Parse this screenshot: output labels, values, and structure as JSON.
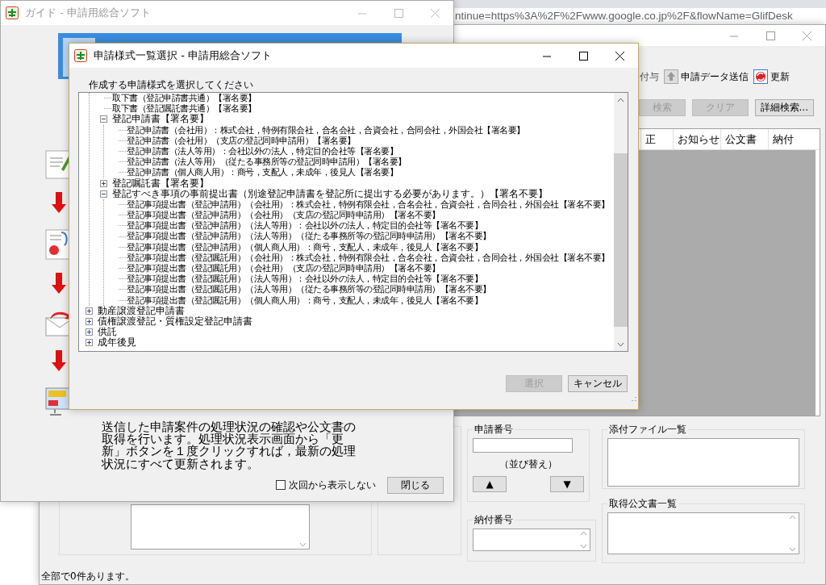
{
  "browser": {
    "address_fragment": "ntinue=https%3A%2F%2Fwww.google.co.jp%2F&flowName=GlifDesk"
  },
  "main_window": {
    "toolbar": [
      {
        "label": "付与",
        "kind": "text"
      },
      {
        "label": "申請データ送信",
        "kind": "upload"
      },
      {
        "label": "更新",
        "kind": "refresh"
      }
    ],
    "search_buttons": [
      {
        "label": "検索",
        "disabled": true
      },
      {
        "label": "クリア",
        "disabled": true
      },
      {
        "label": "詳細検索...",
        "disabled": false
      }
    ],
    "table": {
      "columns": [
        "正",
        "お知らせ",
        "公文書",
        "納付"
      ]
    },
    "application_number": {
      "label": "申請番号"
    },
    "sort": {
      "label": "（並び替え）",
      "buttons": [
        "▲",
        "▼"
      ]
    },
    "payment_number": {
      "label": "納付番号"
    },
    "attachments": {
      "label": "添付ファイル一覧"
    },
    "documents": {
      "label": "取得公文書一覧"
    },
    "status_bar": "全部で0件あります。"
  },
  "guide_window": {
    "title": "ガイド - 申請用総合ソフト",
    "active": false,
    "description": "送信した申請案件の処理状況の確認や公文書の取得を行います。処理状況表示画面から「更新」ボタンを１度クリックすれば，最新の処理状況にすべて更新されます。",
    "dont_show_again": {
      "label": "次回から表示しない",
      "checked": false
    },
    "close_button": "閉じる"
  },
  "dialog": {
    "title": "申請様式一覧選択 - 申請用総合ソフト",
    "active": true,
    "prompt": "作成する申請様式を選択してください",
    "tree": [
      {
        "expanded": true,
        "children": [
          {
            "label": "取下書（登記申請書共通）【署名要】"
          },
          {
            "label": "取下書（登記嘱託書共通）【署名要】"
          },
          {
            "label": "登記申請書【署名要】",
            "expanded": true,
            "children": [
              {
                "label": "登記申請書（会社用）：株式会社，特例有限会社，合名会社，合資会社，合同会社，外国会社【署名要】"
              },
              {
                "label": "登記申請書（会社用）（支店の登記同時申請用）【署名要】"
              },
              {
                "label": "登記申請書（法人等用）：会社以外の法人，特定目的会社等【署名要】"
              },
              {
                "label": "登記申請書（法人等用）（従たる事務所等の登記同時申請用）【署名要】"
              },
              {
                "label": "登記申請書（個人商人用）：商号，支配人，未成年，後見人【署名要】"
              }
            ]
          },
          {
            "label": "登記嘱託書【署名要】",
            "expanded": false
          },
          {
            "label": "登記すべき事項の事前提出書（別途登記申請書を登記所に提出する必要があります。）【署名不要】",
            "expanded": true,
            "children": [
              {
                "label": "登記事項提出書（登記申請用）（会社用）：株式会社，特例有限会社，合名会社，合資会社，合同会社，外国会社【署名不要】"
              },
              {
                "label": "登記事項提出書（登記申請用）（会社用）（支店の登記同時申請用）【署名不要】"
              },
              {
                "label": "登記事項提出書（登記申請用）（法人等用）：会社以外の法人，特定目的会社等【署名不要】"
              },
              {
                "label": "登記事項提出書（登記申請用）（法人等用）（従たる事務所等の登記同時申請用）【署名不要】"
              },
              {
                "label": "登記事項提出書（登記申請用）（個人商人用）：商号，支配人，未成年，後見人【署名不要】"
              },
              {
                "label": "登記事項提出書（登記嘱託用）（会社用）：株式会社，特例有限会社，合名会社，合資会社，合同会社，外国会社【署名不要】"
              },
              {
                "label": "登記事項提出書（登記嘱託用）（会社用）（支店の登記同時申請用）【署名不要】"
              },
              {
                "label": "登記事項提出書（登記嘱託用）（法人等用）：会社以外の法人，特定目的会社等【署名不要】"
              },
              {
                "label": "登記事項提出書（登記嘱託用）（法人等用）（従たる事務所等の登記同時申請用）【署名不要】"
              },
              {
                "label": "登記事項提出書（登記嘱託用）（個人商人用）：商号，支配人，未成年，後見人【署名不要】"
              }
            ]
          }
        ]
      },
      {
        "label": "動産譲渡登記申請書",
        "expanded": false
      },
      {
        "label": "債権譲渡登記・質権設定登記申請書",
        "expanded": false
      },
      {
        "label": "供託",
        "expanded": false
      },
      {
        "label": "成年後見",
        "expanded": false
      }
    ],
    "buttons": [
      {
        "label": "選択",
        "disabled": true
      },
      {
        "label": "キャンセル",
        "disabled": false
      }
    ]
  }
}
